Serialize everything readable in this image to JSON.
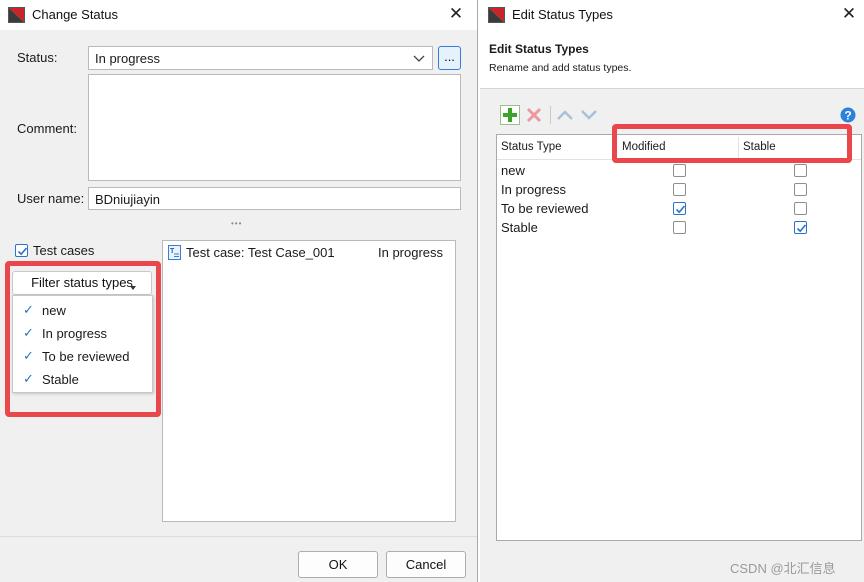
{
  "left_dialog": {
    "title": "Change Status",
    "status_label": "Status:",
    "status_value": "In progress",
    "browse_label": "...",
    "comment_label": "Comment:",
    "comment_value": "",
    "username_label": "User name:",
    "username_value": "BDniujiayin",
    "splitter_dots": "•••",
    "test_cases_label": "Test cases",
    "test_cases_checked": true,
    "filter_button_label": "Filter status types",
    "filter_items": [
      {
        "label": "new",
        "checked": true
      },
      {
        "label": "In progress",
        "checked": true
      },
      {
        "label": "To be reviewed",
        "checked": true
      },
      {
        "label": "Stable",
        "checked": true
      }
    ],
    "test_case_name": "Test case: Test Case_001",
    "test_case_status": "In progress",
    "ok_label": "OK",
    "cancel_label": "Cancel"
  },
  "right_dialog": {
    "title": "Edit Status Types",
    "heading": "Edit Status Types",
    "subheading": "Rename and add status types.",
    "columns": [
      "Status Type",
      "Modified",
      "Stable"
    ],
    "rows": [
      {
        "name": "new",
        "modified": false,
        "stable": false
      },
      {
        "name": "In progress",
        "modified": false,
        "stable": false
      },
      {
        "name": "To be reviewed",
        "modified": true,
        "stable": false
      },
      {
        "name": "Stable",
        "modified": false,
        "stable": true
      }
    ]
  },
  "watermark": "CSDN @北汇信息",
  "colors": {
    "highlight_border": "#e9474c",
    "check_blue": "#2b73c8",
    "dialog_bg": "#f0f0f0"
  },
  "icons": [
    "app-icon",
    "close-icon",
    "chevron-down-icon",
    "checkmark-icon",
    "add-icon",
    "delete-icon",
    "move-up-icon",
    "move-down-icon",
    "help-icon",
    "test-case-icon"
  ]
}
